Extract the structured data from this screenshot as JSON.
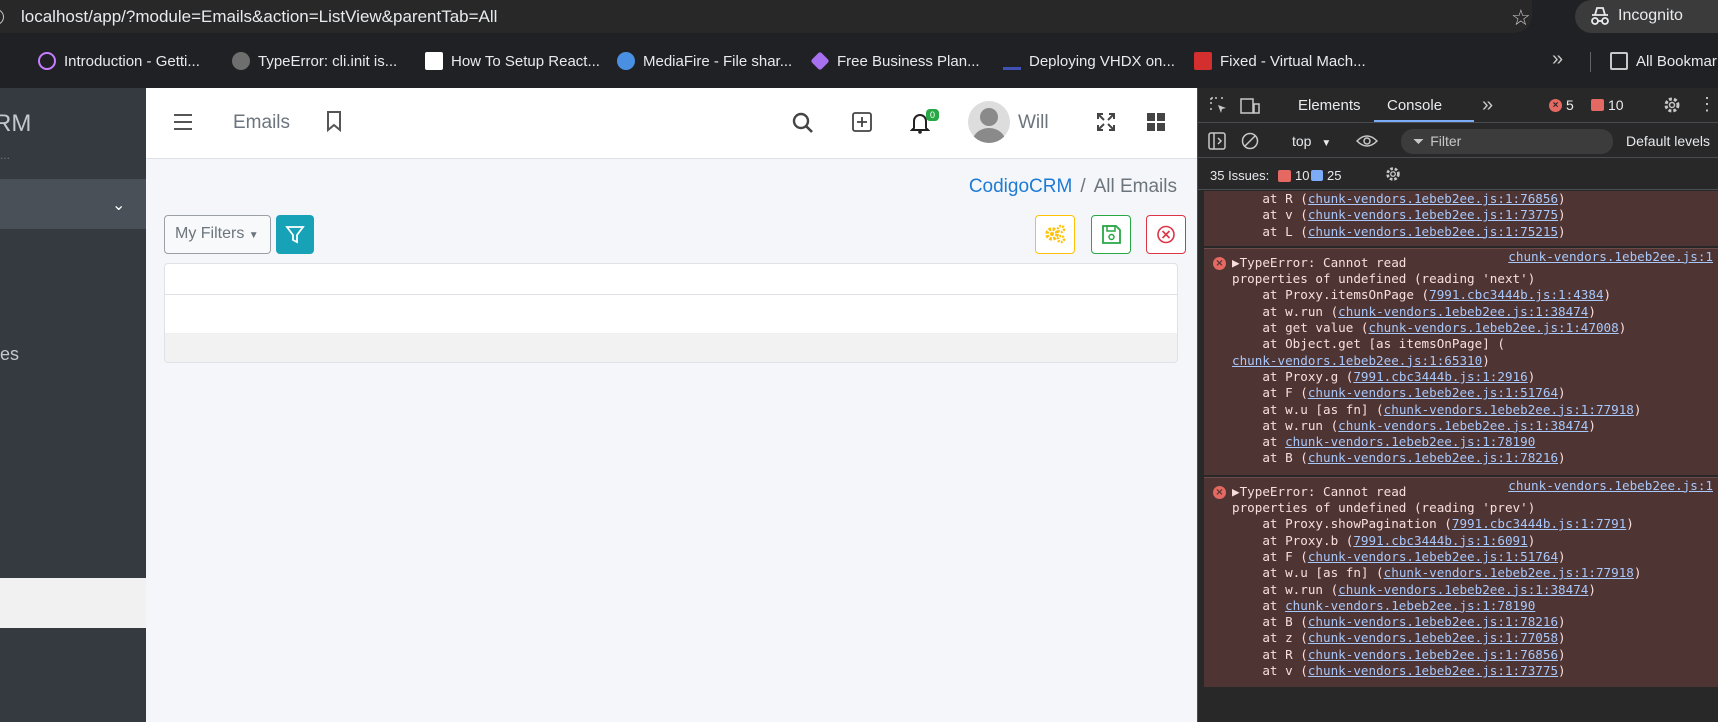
{
  "browser": {
    "url": "localhost/app/?module=Emails&action=ListView&parentTab=All",
    "incognito_label": "Incognito",
    "bookmarks": [
      {
        "label": "Introduction - Getti...",
        "icon": "colorful-rings-icon",
        "color": "#c77dff"
      },
      {
        "label": "TypeError: cli.init is...",
        "icon": "github-icon",
        "color": "#ffffff"
      },
      {
        "label": "How To Setup React...",
        "icon": "triangle-logo-icon",
        "color": "#ffffff"
      },
      {
        "label": "MediaFire - File shar...",
        "icon": "mediafire-icon",
        "color": "#4a90e2"
      },
      {
        "label": "Free Business Plan...",
        "icon": "layers-icon",
        "color": "#a770ef"
      },
      {
        "label": "Deploying VHDX on...",
        "icon": "trend-icon",
        "color": "#3f51b5"
      },
      {
        "label": "Fixed - Virtual Mach...",
        "icon": "mt-logo-icon",
        "color": "#d32f2f"
      }
    ],
    "all_bookmarks_label": "All Bookmar"
  },
  "sidebar": {
    "brand": "RM",
    "sub": "...",
    "partial_item": "es"
  },
  "app": {
    "nav_title": "Emails",
    "notification_count": "0",
    "user_name": "Will",
    "breadcrumb": {
      "link": "CodigoCRM",
      "separator": "/",
      "current": "All Emails"
    },
    "my_filters_label": "My Filters"
  },
  "devtools": {
    "tabs": [
      "Elements",
      "Console"
    ],
    "error_count": "5",
    "warning_count": "10",
    "context": "top",
    "filter_placeholder": "Filter",
    "levels_label": "Default levels",
    "issues_label": "35 Issues:",
    "issues_errors": "10",
    "issues_messages": "25",
    "console": {
      "top_lines": [
        {
          "prefix": "    at R (",
          "link": "chunk-vendors.1ebeb2ee.js:1:76856",
          "suffix": ")"
        },
        {
          "prefix": "    at v (",
          "link": "chunk-vendors.1ebeb2ee.js:1:73775",
          "suffix": ")"
        },
        {
          "prefix": "    at L (",
          "link": "chunk-vendors.1ebeb2ee.js:1:75215",
          "suffix": ")"
        }
      ],
      "errors": [
        {
          "head": "▶TypeError: Cannot read",
          "source": "chunk-vendors.1ebeb2ee.js:1",
          "lines": [
            {
              "prefix": "properties of undefined (reading 'next')",
              "link": "",
              "suffix": ""
            },
            {
              "prefix": "    at Proxy.itemsOnPage (",
              "link": "7991.cbc3444b.js:1:4384",
              "suffix": ")"
            },
            {
              "prefix": "    at w.run (",
              "link": "chunk-vendors.1ebeb2ee.js:1:38474",
              "suffix": ")"
            },
            {
              "prefix": "    at get value (",
              "link": "chunk-vendors.1ebeb2ee.js:1:47008",
              "suffix": ")"
            },
            {
              "prefix": "    at Object.get [as itemsOnPage] (",
              "link": "",
              "suffix": ""
            },
            {
              "prefix": "",
              "link": "chunk-vendors.1ebeb2ee.js:1:65310",
              "suffix": ")"
            },
            {
              "prefix": "    at Proxy.g (",
              "link": "7991.cbc3444b.js:1:2916",
              "suffix": ")"
            },
            {
              "prefix": "    at F (",
              "link": "chunk-vendors.1ebeb2ee.js:1:51764",
              "suffix": ")"
            },
            {
              "prefix": "    at w.u [as fn] (",
              "link": "chunk-vendors.1ebeb2ee.js:1:77918",
              "suffix": ")"
            },
            {
              "prefix": "    at w.run (",
              "link": "chunk-vendors.1ebeb2ee.js:1:38474",
              "suffix": ")"
            },
            {
              "prefix": "    at ",
              "link": "chunk-vendors.1ebeb2ee.js:1:78190",
              "suffix": ""
            },
            {
              "prefix": "    at B (",
              "link": "chunk-vendors.1ebeb2ee.js:1:78216",
              "suffix": ")"
            }
          ]
        },
        {
          "head": "▶TypeError: Cannot read",
          "source": "chunk-vendors.1ebeb2ee.js:1",
          "lines": [
            {
              "prefix": "properties of undefined (reading 'prev')",
              "link": "",
              "suffix": ""
            },
            {
              "prefix": "    at Proxy.showPagination (",
              "link": "7991.cbc3444b.js:1:7791",
              "suffix": ")"
            },
            {
              "prefix": "    at Proxy.b (",
              "link": "7991.cbc3444b.js:1:6091",
              "suffix": ")"
            },
            {
              "prefix": "    at F (",
              "link": "chunk-vendors.1ebeb2ee.js:1:51764",
              "suffix": ")"
            },
            {
              "prefix": "    at w.u [as fn] (",
              "link": "chunk-vendors.1ebeb2ee.js:1:77918",
              "suffix": ")"
            },
            {
              "prefix": "    at w.run (",
              "link": "chunk-vendors.1ebeb2ee.js:1:38474",
              "suffix": ")"
            },
            {
              "prefix": "    at ",
              "link": "chunk-vendors.1ebeb2ee.js:1:78190",
              "suffix": ""
            },
            {
              "prefix": "    at B (",
              "link": "chunk-vendors.1ebeb2ee.js:1:78216",
              "suffix": ")"
            },
            {
              "prefix": "    at z (",
              "link": "chunk-vendors.1ebeb2ee.js:1:77058",
              "suffix": ")"
            },
            {
              "prefix": "    at R (",
              "link": "chunk-vendors.1ebeb2ee.js:1:76856",
              "suffix": ")"
            },
            {
              "prefix": "    at v (",
              "link": "chunk-vendors.1ebeb2ee.js:1:73775",
              "suffix": ")"
            }
          ]
        }
      ]
    }
  },
  "colors": {
    "accent": "#1e7bd3",
    "info": "#17a2b8",
    "warning": "#ffc107",
    "success": "#28a745",
    "danger": "#dc3545",
    "console_error_bg": "#4e3534"
  }
}
